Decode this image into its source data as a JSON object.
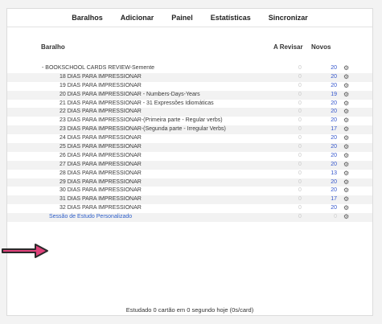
{
  "toolbar": {
    "decks": "Baralhos",
    "add": "Adicionar",
    "browse": "Painel",
    "stats": "Estatísticas",
    "sync": "Sincronizar"
  },
  "columns": {
    "deck": "Baralho",
    "due": "A Revisar",
    "new": "Novos"
  },
  "rows": [
    {
      "name": "- BOOKSCHOOL CARDS REVIEW-Semente",
      "due": "0",
      "new": "20"
    },
    {
      "name": "18 DIAS PARA IMPRESSIONAR",
      "due": "0",
      "new": "20"
    },
    {
      "name": "19 DIAS PARA IMPRESSIONAR",
      "due": "0",
      "new": "20"
    },
    {
      "name": "20 DIAS PARA IMPRESSIONAR - Numbers-Days-Years",
      "due": "0",
      "new": "19"
    },
    {
      "name": "21 DIAS PARA IMPRESSIONAR - 31 Expressões Idiomáticas",
      "due": "0",
      "new": "20"
    },
    {
      "name": "22 DIAS PARA IMPRESSIONAR",
      "due": "0",
      "new": "20"
    },
    {
      "name": "23 DIAS PARA IMPRESSIONAR-(Primeira parte - Regular verbs)",
      "due": "0",
      "new": "20"
    },
    {
      "name": "23 DIAS PARA IMPRESSIONAR-(Segunda parte - Irregular Verbs)",
      "due": "0",
      "new": "17"
    },
    {
      "name": "24 DIAS PARA IMPRESSIONAR",
      "due": "0",
      "new": "20"
    },
    {
      "name": "25 DIAS PARA IMPRESSIONAR",
      "due": "0",
      "new": "20"
    },
    {
      "name": "26 DIAS PARA IMPRESSIONAR",
      "due": "0",
      "new": "20"
    },
    {
      "name": "27 DIAS PARA IMPRESSIONAR",
      "due": "0",
      "new": "20"
    },
    {
      "name": "28 DIAS PARA IMPRESSIONAR",
      "due": "0",
      "new": "13"
    },
    {
      "name": "29 DIAS PARA IMPRESSIONAR",
      "due": "0",
      "new": "20"
    },
    {
      "name": "30 DIAS PARA IMPRESSIONAR",
      "due": "0",
      "new": "20"
    },
    {
      "name": "31 DIAS PARA IMPRESSIONAR",
      "due": "0",
      "new": "17"
    },
    {
      "name": "32 DIAS PARA IMPRESSIONAR",
      "due": "0",
      "new": "20"
    },
    {
      "name": "Sessão de Estudo Personalizado",
      "due": "0",
      "new": "0"
    }
  ],
  "footer": "Estudado 0 cartão em 0 segundo hoje (0s/card)",
  "colors": {
    "link": "#2e5fc9",
    "count_new": "#3355cc",
    "arrow": "#e0417a"
  },
  "icons": {
    "options": "gear-icon",
    "pointer": "arrow-icon"
  }
}
